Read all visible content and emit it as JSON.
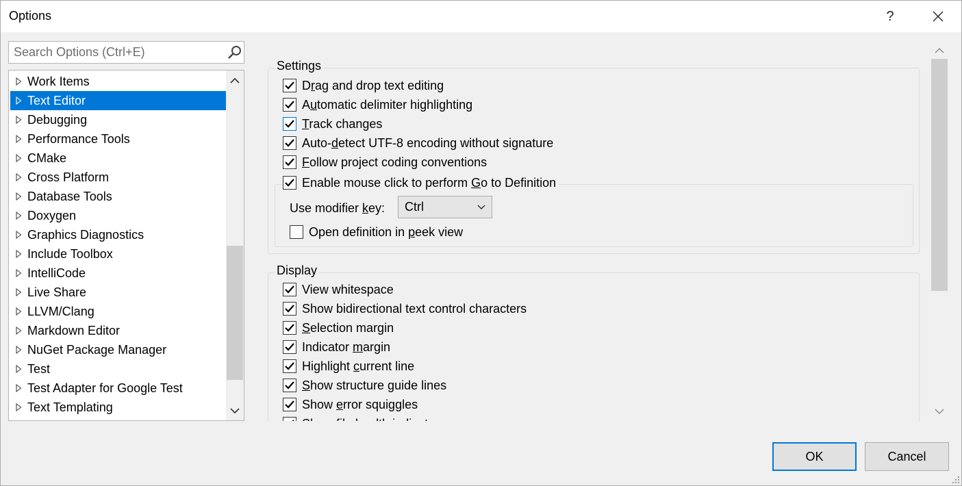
{
  "window": {
    "title": "Options",
    "help_label": "?",
    "close_label": "✕"
  },
  "search": {
    "placeholder": "Search Options (Ctrl+E)"
  },
  "tree": {
    "items": [
      {
        "label": "Work Items",
        "selected": false
      },
      {
        "label": "Text Editor",
        "selected": true
      },
      {
        "label": "Debugging",
        "selected": false
      },
      {
        "label": "Performance Tools",
        "selected": false
      },
      {
        "label": "CMake",
        "selected": false
      },
      {
        "label": "Cross Platform",
        "selected": false
      },
      {
        "label": "Database Tools",
        "selected": false
      },
      {
        "label": "Doxygen",
        "selected": false
      },
      {
        "label": "Graphics Diagnostics",
        "selected": false
      },
      {
        "label": "Include Toolbox",
        "selected": false
      },
      {
        "label": "IntelliCode",
        "selected": false
      },
      {
        "label": "Live Share",
        "selected": false
      },
      {
        "label": "LLVM/Clang",
        "selected": false
      },
      {
        "label": "Markdown Editor",
        "selected": false
      },
      {
        "label": "NuGet Package Manager",
        "selected": false
      },
      {
        "label": "Test",
        "selected": false
      },
      {
        "label": "Test Adapter for Google Test",
        "selected": false
      },
      {
        "label": "Text Templating",
        "selected": false
      }
    ]
  },
  "settings": {
    "title": "Settings",
    "options": [
      {
        "pre": "D",
        "u": "r",
        "post": "ag and drop text editing",
        "checked": true
      },
      {
        "pre": "A",
        "u": "u",
        "post": "tomatic delimiter highlighting",
        "checked": true
      },
      {
        "pre": "",
        "u": "T",
        "post": "rack changes",
        "checked": true
      },
      {
        "pre": "Auto-",
        "u": "d",
        "post": "etect UTF-8 encoding without signature",
        "checked": true
      },
      {
        "pre": "",
        "u": "F",
        "post": "ollow project coding conventions",
        "checked": true
      },
      {
        "pre": "Enable mouse click to perform ",
        "u": "G",
        "post": "o to Definition",
        "checked": true
      }
    ],
    "modifier_label_pre": "Use modifier ",
    "modifier_label_u": "k",
    "modifier_label_post": "ey:",
    "modifier_value": "Ctrl",
    "peek": {
      "pre": "Open definition in ",
      "u": "p",
      "post": "eek view",
      "checked": false
    }
  },
  "display": {
    "title": "Display",
    "options": [
      {
        "pre": "View whitespace",
        "u": "",
        "post": "",
        "checked": true
      },
      {
        "pre": "Show bidirectional text control characters",
        "u": "",
        "post": "",
        "checked": true
      },
      {
        "pre": "",
        "u": "S",
        "post": "election margin",
        "checked": true
      },
      {
        "pre": "Indicator ",
        "u": "m",
        "post": "argin",
        "checked": true
      },
      {
        "pre": "Highlight ",
        "u": "c",
        "post": "urrent line",
        "checked": true
      },
      {
        "pre": "",
        "u": "S",
        "post": "how structure guide lines",
        "checked": true
      },
      {
        "pre": "Show ",
        "u": "e",
        "post": "rror squiggles",
        "checked": true
      },
      {
        "pre": "Show file health indicator",
        "u": "",
        "post": "",
        "checked": true
      }
    ]
  },
  "buttons": {
    "ok": "OK",
    "cancel": "Cancel"
  },
  "colors": {
    "accent": "#0078d7",
    "check": "#000000"
  }
}
